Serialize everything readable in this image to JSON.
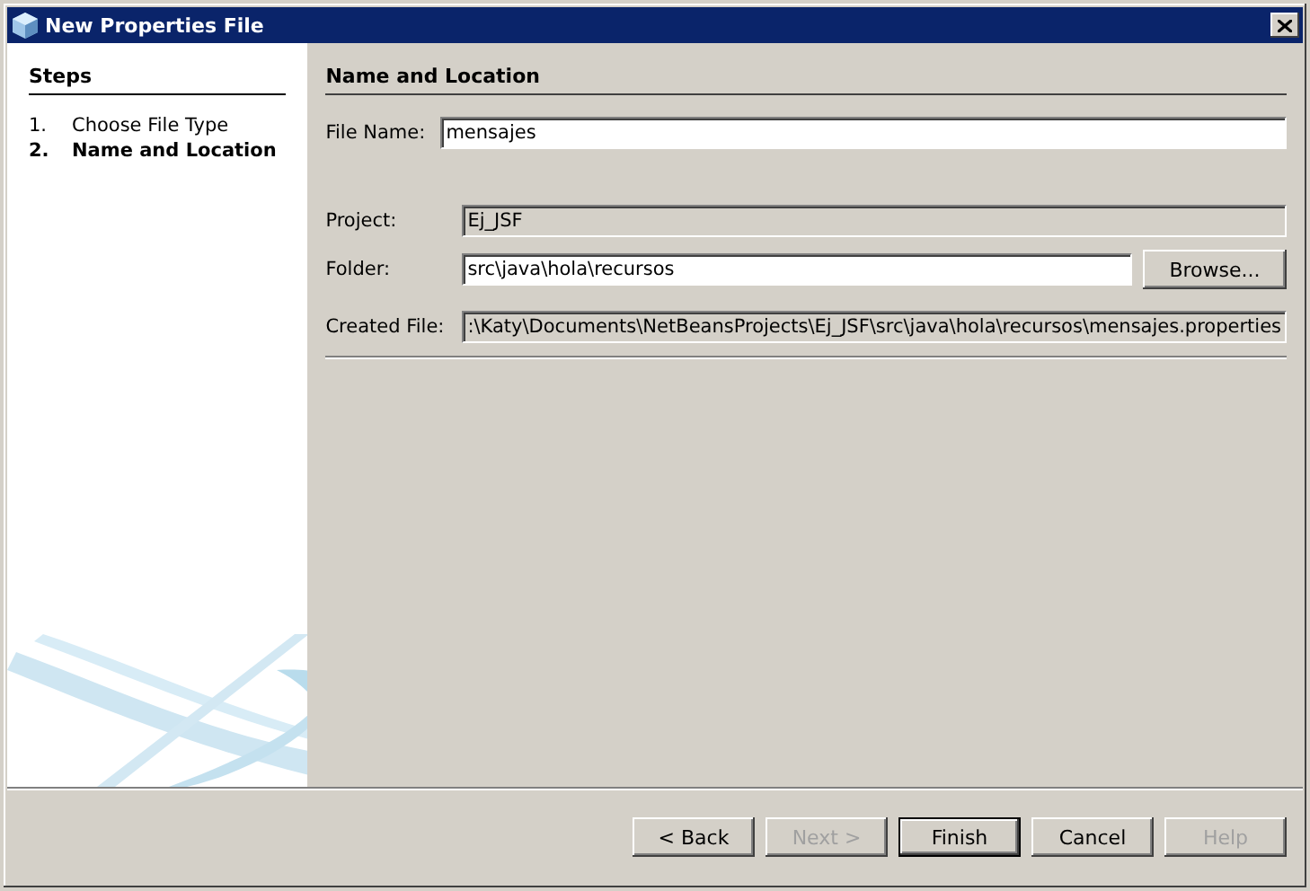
{
  "window": {
    "title": "New Properties File"
  },
  "steps": {
    "title": "Steps",
    "items": [
      {
        "number": "1.",
        "label": "Choose File Type",
        "selected": false
      },
      {
        "number": "2.",
        "label": "Name and Location",
        "selected": true
      }
    ]
  },
  "panel": {
    "title": "Name and Location",
    "file_name": {
      "label": "File Name:",
      "value": "mensajes"
    },
    "fields": [
      {
        "label": "Project:",
        "value": "Ej_JSF",
        "disabled": true
      },
      {
        "label": "Folder:",
        "value": "src\\java\\hola\\recursos",
        "disabled": false,
        "button": "Browse..."
      },
      {
        "label": "Created File:",
        "value": ":\\Katy\\Documents\\NetBeansProjects\\Ej_JSF\\src\\java\\hola\\recursos\\mensajes.properties",
        "disabled": true
      }
    ]
  },
  "buttons": [
    {
      "label": "< Back",
      "disabled": false,
      "default": false
    },
    {
      "label": "Next >",
      "disabled": true,
      "default": false
    },
    {
      "label": "Finish",
      "disabled": false,
      "default": true
    },
    {
      "label": "Cancel",
      "disabled": false,
      "default": false
    },
    {
      "label": "Help",
      "disabled": true,
      "default": false
    }
  ]
}
